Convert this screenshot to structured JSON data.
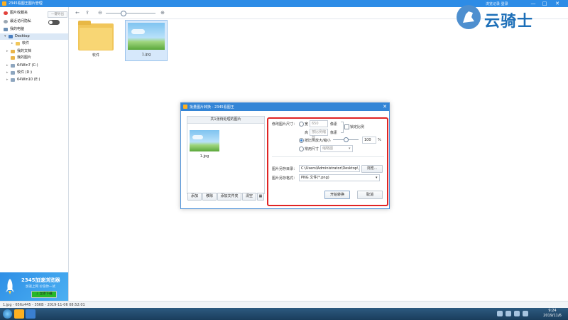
{
  "titlebar": {
    "title": "2345看图王图片管理",
    "right_small": "浏览记录 登录",
    "min": "—",
    "max": "□",
    "close": "✕"
  },
  "sidebar": {
    "favorites": "图片收藏夹",
    "lock_btn": "一键导出",
    "recent": "最近访问隐私",
    "mypc": "我的电脑",
    "desktop": "Desktop",
    "software": "软件",
    "mydocs": "我的文档",
    "mypics": "我的图片",
    "drive_c": "64Win7 (C:)",
    "drive_d": "软件 (D:)",
    "drive_e": "64Win10 (E:)"
  },
  "ad": {
    "title": "2345加速浏览器",
    "subtitle": "加速上网 价值你一试",
    "button": "⊥ 立即下载"
  },
  "files": [
    {
      "label": "软件"
    },
    {
      "label": "1.jpg"
    }
  ],
  "status": "1.jpg - 656x445 - 35KB - 2019-11-06 08:52:01",
  "clock": {
    "time": "9:24",
    "date": "2019/11/6"
  },
  "watermark": {
    "text": "云骑士"
  },
  "dialog": {
    "title": "批量图片转换 - 2345看图王",
    "list_header": "共1张待处理的图片",
    "file": "1.jpg",
    "buttons": {
      "add": "添加",
      "remove": "移除",
      "add_folder": "添加文件夹",
      "clear": "清空"
    },
    "resize_label": "修改图片尺寸：",
    "width_label": "宽",
    "width_value": "650",
    "width_unit": "像素",
    "height_label": "高",
    "height_placeholder": "按比例缩放",
    "height_unit": "像素",
    "keep_ratio": "锁定比例",
    "scale_label": "按比例放大/缩小",
    "scale_value": "100",
    "scale_unit": "%",
    "common_label": "常用尺寸",
    "common_value": "缩略图",
    "save_dir_label": "图片另存目录：",
    "save_dir_value": "C:\\Users\\Administrator\\Desktop\\",
    "browse": "浏览...",
    "format_label": "图片另存格式：",
    "format_value": "PNG 文件(*.png)",
    "start": "开始转换",
    "cancel": "取消"
  }
}
